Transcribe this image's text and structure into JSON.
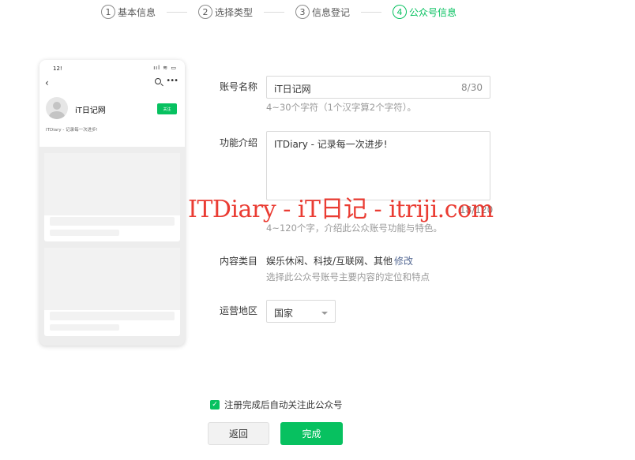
{
  "steps": [
    {
      "num": "1",
      "label": "基本信息"
    },
    {
      "num": "2",
      "label": "选择类型"
    },
    {
      "num": "3",
      "label": "信息登记"
    },
    {
      "num": "4",
      "label": "公众号信息"
    }
  ],
  "preview": {
    "time": "12!",
    "status_icons": "ııl ≋ ▭",
    "account_name": "iT日记网",
    "follow_label": "关注",
    "intro": "ITDiary - 记录每一次进步!",
    "back_icon": "chevron-left-icon",
    "search_icon": "search-icon",
    "more_icon": "more-icon"
  },
  "form": {
    "account_name_label": "账号名称",
    "account_name_value": "iT日记网",
    "account_name_count": "8/30",
    "account_name_hint": "4~30个字符（1个汉字算2个字符）。",
    "intro_label": "功能介绍",
    "intro_value": "ITDiary - 记录每一次进步!",
    "intro_count": "18/120",
    "intro_hint": "4~120个字，介绍此公众账号功能与特色。",
    "category_label": "内容类目",
    "category_value": "娱乐休闲、科技/互联网、其他",
    "category_edit": "修改",
    "category_hint": "选择此公众号账号主要内容的定位和特点",
    "region_label": "运营地区",
    "region_value": "国家"
  },
  "watermark": "ITDiary - iT日记 - itriji.com",
  "auto_follow": {
    "checked": true,
    "label": "注册完成后自动关注此公众号"
  },
  "buttons": {
    "back": "返回",
    "done": "完成"
  },
  "colors": {
    "accent": "#07c160",
    "link": "#576b95",
    "watermark": "#e8281e"
  }
}
